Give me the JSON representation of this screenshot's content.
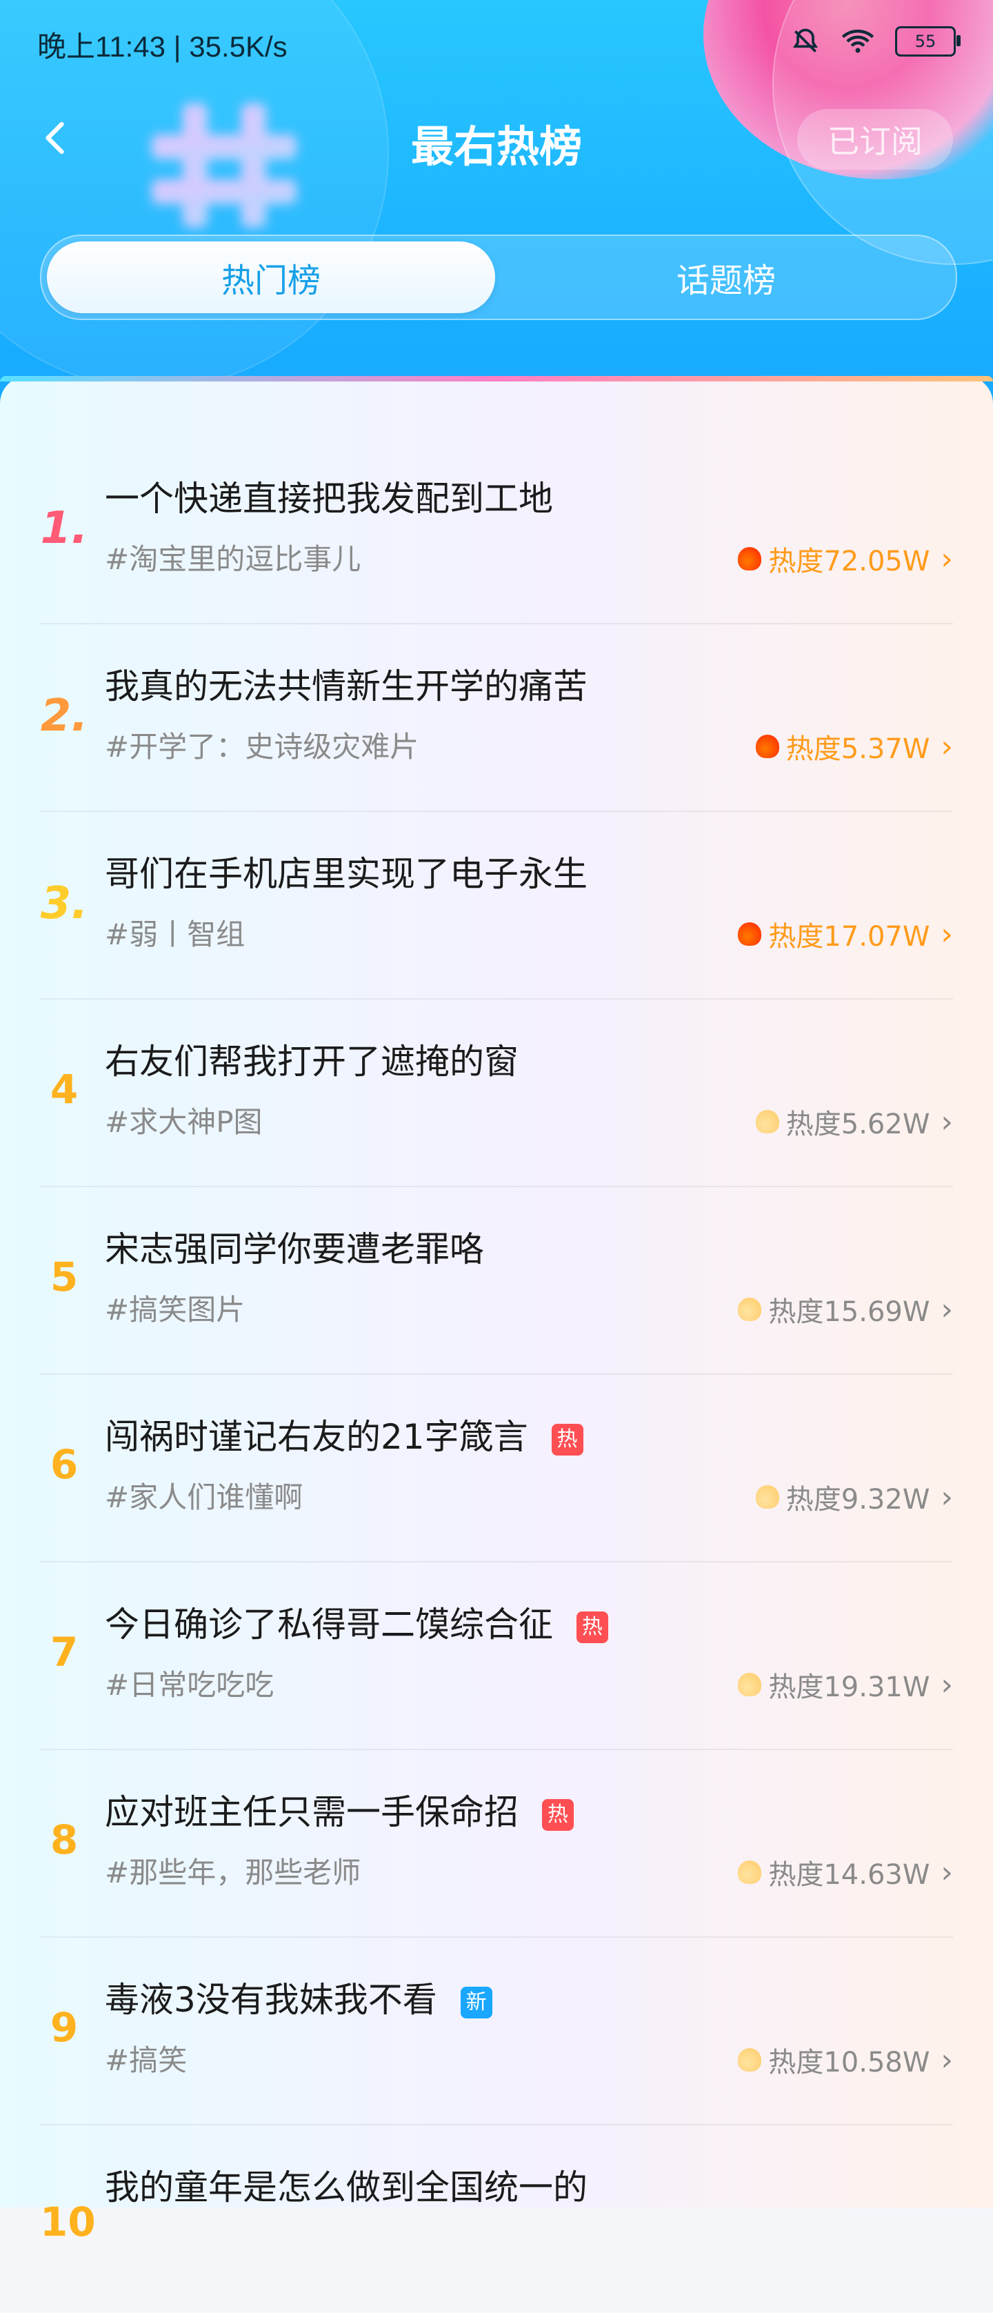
{
  "status_bar": {
    "time_speed": "晚上11:43 | 35.5K/s",
    "battery": "55"
  },
  "header": {
    "title": "最右热榜",
    "subscribe_label": "已订阅"
  },
  "tabs": [
    {
      "label": "热门榜"
    },
    {
      "label": "话题榜"
    }
  ],
  "list": [
    {
      "rank": "1.",
      "title": "一个快递直接把我发配到工地",
      "tag": "#淘宝里的逗比事儿",
      "heat": "热度72.05W",
      "badge": ""
    },
    {
      "rank": "2.",
      "title": "我真的无法共情新生开学的痛苦",
      "tag": "#开学了：史诗级灾难片",
      "heat": "热度5.37W",
      "badge": ""
    },
    {
      "rank": "3.",
      "title": "哥们在手机店里实现了电子永生",
      "tag": "#弱丨智组",
      "heat": "热度17.07W",
      "badge": ""
    },
    {
      "rank": "4",
      "title": "右友们帮我打开了遮掩的窗",
      "tag": "#求大神P图",
      "heat": "热度5.62W",
      "badge": ""
    },
    {
      "rank": "5",
      "title": "宋志强同学你要遭老罪咯",
      "tag": "#搞笑图片",
      "heat": "热度15.69W",
      "badge": ""
    },
    {
      "rank": "6",
      "title": "闯祸时谨记右友的21字箴言",
      "tag": "#家人们谁懂啊",
      "heat": "热度9.32W",
      "badge": "热"
    },
    {
      "rank": "7",
      "title": "今日确诊了私得哥二馍综合征",
      "tag": "#日常吃吃吃",
      "heat": "热度19.31W",
      "badge": "热"
    },
    {
      "rank": "8",
      "title": "应对班主任只需一手保命招",
      "tag": "#那些年，那些老师",
      "heat": "热度14.63W",
      "badge": "热"
    },
    {
      "rank": "9",
      "title": "毒液3没有我妹我不看",
      "tag": "#搞笑",
      "heat": "热度10.58W",
      "badge": "新"
    },
    {
      "rank": "10",
      "title": "我的童年是怎么做到全国统一的",
      "tag": "",
      "heat": "",
      "badge": ""
    }
  ],
  "icons": {
    "back": "chevron-left-icon",
    "bell": "bell-off-icon",
    "wifi": "wifi-icon",
    "battery": "battery-icon",
    "flame": "flame-icon",
    "chevron": "chevron-right-icon"
  }
}
